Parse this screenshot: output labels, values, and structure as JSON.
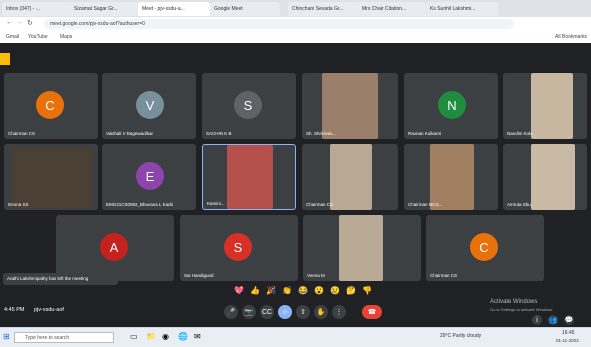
{
  "browser": {
    "tabs": [
      {
        "label": "Inbox (347) - ..."
      },
      {
        "label": "Sizamat Sagar Gr..."
      },
      {
        "label": "Meet - pjv-xsdu-a..."
      },
      {
        "label": "Google Meet"
      },
      {
        "label": "Chinchani Sevada Gr..."
      },
      {
        "label": "Mrs Chair Citation..."
      },
      {
        "label": "Ks Sunhil Lakshmi..."
      }
    ],
    "url": "meet.google.com/pjv-xsdu-aof?authuser=0",
    "bookmarks": [
      "Gmail",
      "YouTube",
      "Maps"
    ],
    "all_bookmarks": "All Bookmarks"
  },
  "meet": {
    "tiles_row1": [
      {
        "initial": "C",
        "name": "Chairman CS",
        "color": "#e8710a"
      },
      {
        "initial": "V",
        "name": "Vaishali V Bagewadikar",
        "color": "#78909c"
      },
      {
        "initial": "S",
        "name": "SACHIN K B",
        "color": "#5f6368"
      },
      {
        "initial": "",
        "name": "Sh. Shrinivas...",
        "color": ""
      },
      {
        "initial": "N",
        "name": "Ravnan Kulkarni",
        "color": "#1e8e3e"
      },
      {
        "initial": "",
        "name": "Nandini Kolo",
        "color": ""
      }
    ],
    "tiles_row2": [
      {
        "initial": "",
        "name": "Deona SS",
        "color": ""
      },
      {
        "initial": "E",
        "name": "EMG21CS0082_Bhuvana L Kadri",
        "color": "#8e44ad"
      },
      {
        "initial": "",
        "name": "Kamini...",
        "color": ""
      },
      {
        "initial": "",
        "name": "Chairman CS",
        "color": ""
      },
      {
        "initial": "",
        "name": "Chairman MCS...",
        "color": ""
      },
      {
        "initial": "",
        "name": "Amruta Sbu...",
        "color": ""
      }
    ],
    "tiles_row3": [
      {
        "initial": "A",
        "name": "",
        "color": "#c5221f"
      },
      {
        "initial": "S",
        "name": "Sai Handigund",
        "color": "#d93025"
      },
      {
        "initial": "",
        "name": "Veena M",
        "color": ""
      },
      {
        "initial": "C",
        "name": "Chairman CS",
        "color": "#e8710a"
      }
    ],
    "toast": "Arathi Lakshmipathy has left the meeting",
    "meeting_time": "4:45 PM",
    "meeting_code": "pjv-xsdu-aof",
    "activate_title": "Activate Windows",
    "activate_sub": "Go to Settings to activate Windows."
  },
  "taskbar": {
    "search_placeholder": "Type here to search",
    "weather": "29°C  Partly cloudy",
    "time": "16:45",
    "date": "01-11-2023"
  }
}
